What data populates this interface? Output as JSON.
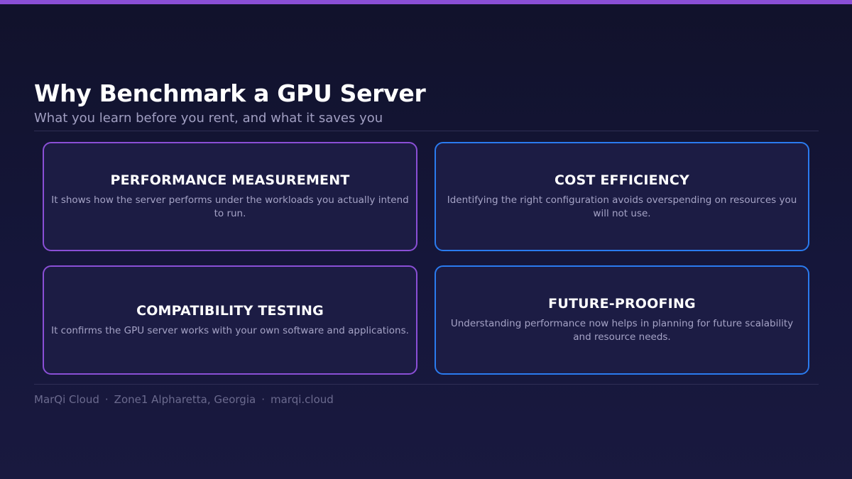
{
  "header": {
    "title": "Why Benchmark a GPU Server",
    "subtitle": "What you learn before you rent, and what it saves you"
  },
  "cards": [
    {
      "title": "PERFORMANCE MEASUREMENT",
      "text": "It shows how the server performs under the workloads you actually intend to run."
    },
    {
      "title": "COST EFFICIENCY",
      "text": "Identifying the right configuration avoids overspending on resources you will not use."
    },
    {
      "title": "COMPATIBILITY TESTING",
      "text": "It confirms the GPU server works with your own software and applications."
    },
    {
      "title": "FUTURE-PROOFING",
      "text": "Understanding performance now helps in planning for future scalability and resource needs."
    }
  ],
  "footer": {
    "brand": "MarQi Cloud",
    "location": "Zone1 Alpharetta, Georgia",
    "site": "marqi.cloud",
    "separator": "·"
  },
  "colors": {
    "accent_purple": "#8a4fd6",
    "accent_blue": "#2a7bef",
    "background": "#14153a",
    "card_background": "#1c1c44"
  }
}
